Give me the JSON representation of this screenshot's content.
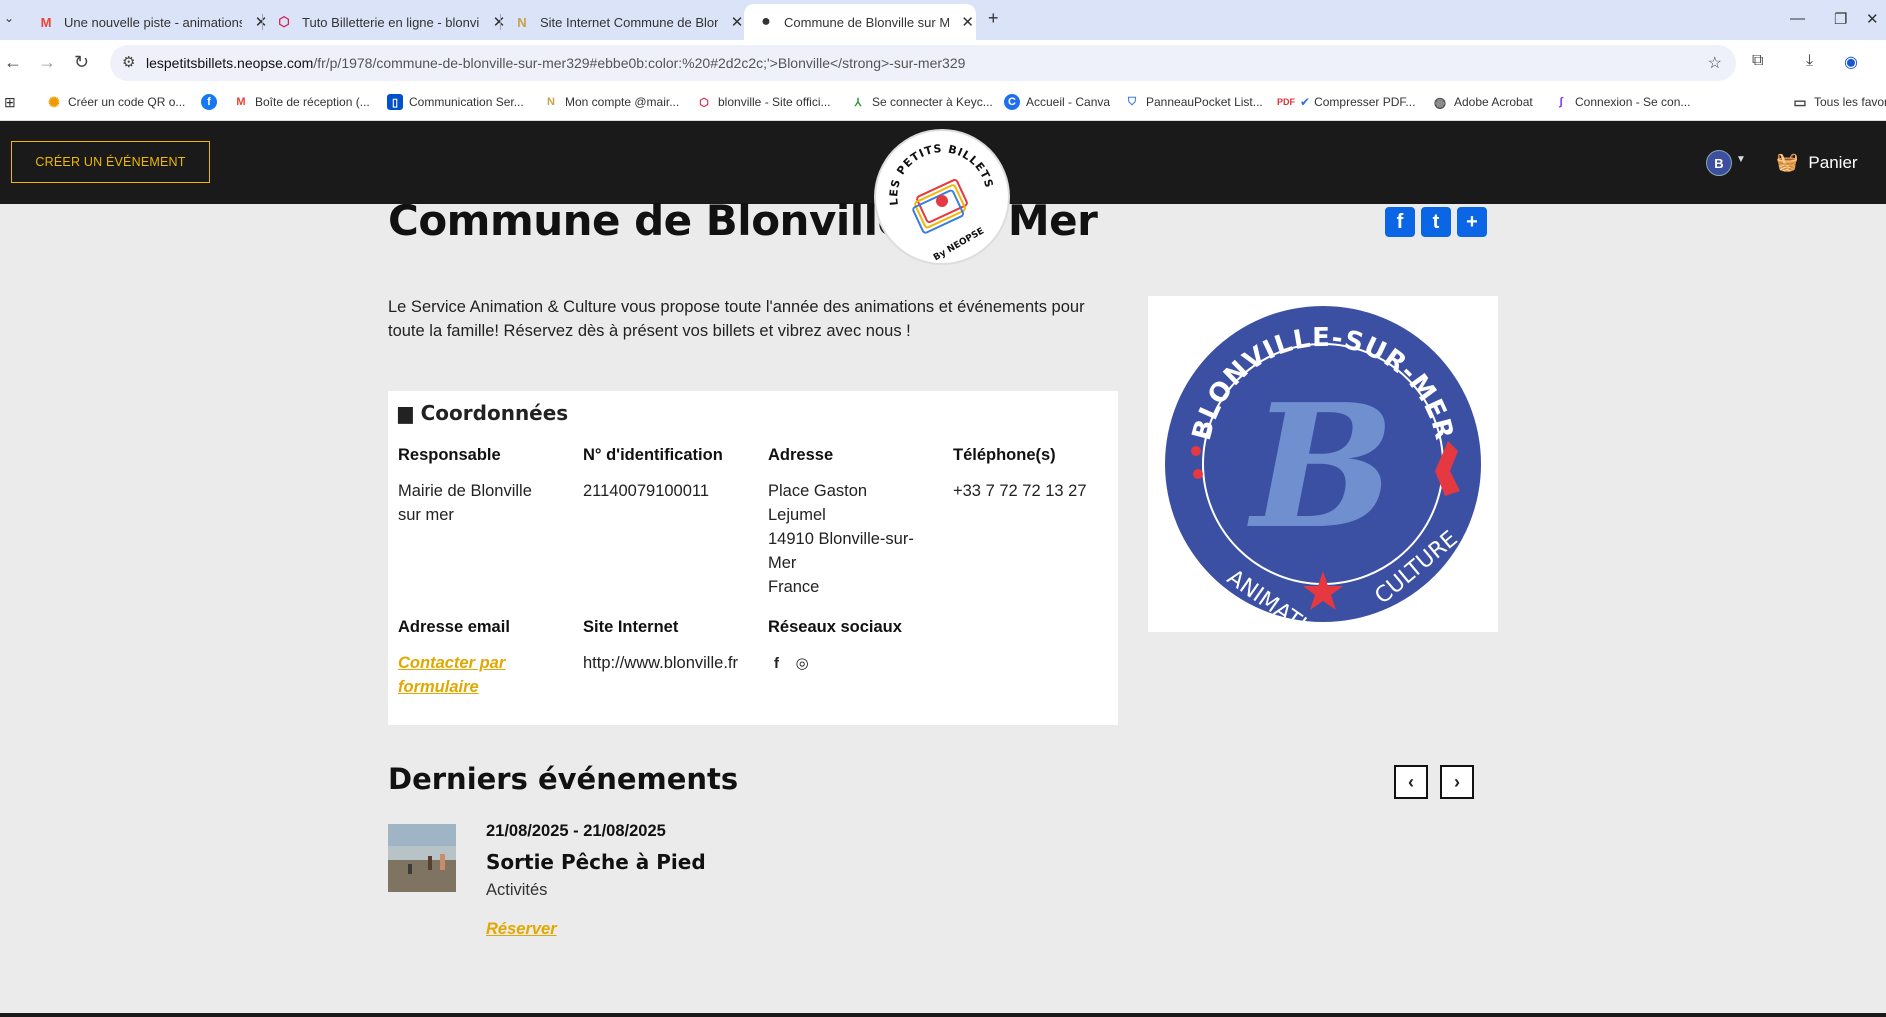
{
  "browser": {
    "tabs": [
      {
        "title": "Une nouvelle piste - animations",
        "icon": "gmail-icon",
        "active": false
      },
      {
        "title": "Tuto Billetterie en ligne - blonville",
        "icon": "hexagon-icon",
        "active": false
      },
      {
        "title": "Site Internet Commune de Blonville",
        "icon": "notion-icon",
        "active": false
      },
      {
        "title": "Commune de Blonville sur Mer",
        "icon": "dot-icon",
        "active": true
      }
    ],
    "url_host": "lespetitsbillets.neopse.com",
    "url_path": "/fr/p/1978/commune-de-blonville-sur-mer329#ebbe0b:color:%20#2d2c2c;'>Blonville</strong>-sur-mer329",
    "bookmarks": [
      {
        "label": "Créer un code QR o...",
        "icon": "gear-icon",
        "color": "#f29900"
      },
      {
        "label": "",
        "icon": "facebook-icon",
        "color": "#1877f2"
      },
      {
        "label": "Boîte de réception (...",
        "icon": "gmail-icon",
        "color": "#ea4335"
      },
      {
        "label": "Communication Ser...",
        "icon": "trello-icon",
        "color": "#0052cc"
      },
      {
        "label": "Mon compte @mair...",
        "icon": "notion-icon",
        "color": "#c8a24a"
      },
      {
        "label": "blonville - Site offici...",
        "icon": "hexagon-icon",
        "color": "#d6204e"
      },
      {
        "label": "Se connecter à Keyc...",
        "icon": "keycloak-icon",
        "color": "#2f9e44"
      },
      {
        "label": "Accueil - Canva",
        "icon": "canva-icon",
        "color": "#1f6feb"
      },
      {
        "label": "PanneauPocket List...",
        "icon": "shield-icon",
        "color": "#3b7ddd"
      },
      {
        "label": "Compresser PDF...",
        "icon": "pdf-icon",
        "color": "#d33"
      },
      {
        "label": "Adobe Acrobat",
        "icon": "globe-icon",
        "color": "#555"
      },
      {
        "label": "Connexion - Se con...",
        "icon": "pen-icon",
        "color": "#7b2ff7"
      },
      {
        "label": "Tous les favoris",
        "icon": "folder-icon",
        "color": "#444"
      }
    ]
  },
  "header": {
    "create_event_label": "CRÉER UN ÉVÉNEMENT",
    "logo_top": "LES PETITS BILLETS",
    "logo_bottom": "By NEOPSE",
    "cart_label": "Panier",
    "avatar_letter": "B"
  },
  "page": {
    "title": "Commune de Blonville sur Mer",
    "share": [
      "f",
      "t",
      "+"
    ],
    "intro": "Le Service Animation & Culture vous propose toute l'année des animations et événements pour toute la famille! Réservez dès à présent vos billets et vibrez avec nous !",
    "org_logo": {
      "ring_top": "BLONVILLE-SUR-MER",
      "ring_left": "ANIMATION",
      "ring_right": "CULTURE",
      "letter": "B",
      "colors": {
        "ring": "#3b50a3",
        "letter": "#6f8fcf",
        "accent": "#e53840"
      }
    }
  },
  "coords": {
    "heading": "Coordonnées",
    "responsable_label": "Responsable",
    "responsable_value": "Mairie de Blonville sur mer",
    "id_label": "N° d'identification",
    "id_value": "21140079100011",
    "address_label": "Adresse",
    "address_lines": [
      "Place Gaston Lejumel",
      "14910 Blonville-sur-Mer",
      "France"
    ],
    "phone_label": "Téléphone(s)",
    "phone_value": "+33 7 72 72 13 27",
    "email_label": "Adresse email",
    "email_link": "Contacter par formulaire",
    "site_label": "Site Internet",
    "site_value": "http://www.blonville.fr",
    "social_label": "Réseaux sociaux"
  },
  "events": {
    "heading": "Derniers événements",
    "items": [
      {
        "dates": "21/08/2025 - 21/08/2025",
        "name": "Sortie Pêche à Pied",
        "category": "Activités",
        "book_label": "Réserver"
      }
    ]
  },
  "colors": {
    "accent": "#e0a800",
    "header_bg": "#1a1a1a",
    "page_bg": "#ebebeb"
  }
}
